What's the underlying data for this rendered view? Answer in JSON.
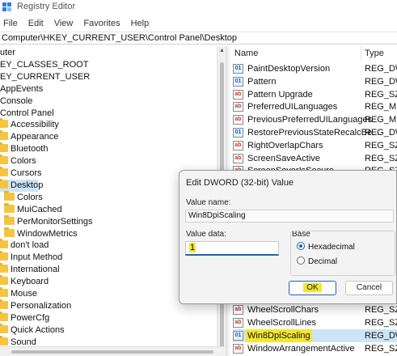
{
  "window": {
    "title": "Registry Editor"
  },
  "menu": [
    "File",
    "Edit",
    "View",
    "Favorites",
    "Help"
  ],
  "address": "Computer\\HKEY_CURRENT_USER\\Control Panel\\Desktop",
  "tree": [
    {
      "label": "uter",
      "indent": 0,
      "folder": false
    },
    {
      "label": "EY_CLASSES_ROOT",
      "indent": 0,
      "folder": false
    },
    {
      "label": "EY_CURRENT_USER",
      "indent": 0,
      "folder": false
    },
    {
      "label": "AppEvents",
      "indent": 0,
      "folder": false
    },
    {
      "label": "Console",
      "indent": 0,
      "folder": false
    },
    {
      "label": "Control Panel",
      "indent": 0,
      "folder": false
    },
    {
      "label": "Accessibility",
      "indent": 1,
      "folder": true
    },
    {
      "label": "Appearance",
      "indent": 1,
      "folder": true
    },
    {
      "label": "Bluetooth",
      "indent": 1,
      "folder": true
    },
    {
      "label": "Colors",
      "indent": 1,
      "folder": true
    },
    {
      "label": "Cursors",
      "indent": 1,
      "folder": true
    },
    {
      "label": "Desktop",
      "indent": 1,
      "folder": true,
      "selected": true
    },
    {
      "label": "Colors",
      "indent": 2,
      "folder": true
    },
    {
      "label": "MuiCached",
      "indent": 2,
      "folder": true
    },
    {
      "label": "PerMonitorSettings",
      "indent": 2,
      "folder": true
    },
    {
      "label": "WindowMetrics",
      "indent": 2,
      "folder": true
    },
    {
      "label": "don't load",
      "indent": 1,
      "folder": true
    },
    {
      "label": "Input Method",
      "indent": 1,
      "folder": true
    },
    {
      "label": "International",
      "indent": 1,
      "folder": true
    },
    {
      "label": "Keyboard",
      "indent": 1,
      "folder": true
    },
    {
      "label": "Mouse",
      "indent": 1,
      "folder": true
    },
    {
      "label": "Personalization",
      "indent": 1,
      "folder": true
    },
    {
      "label": "PowerCfg",
      "indent": 1,
      "folder": true
    },
    {
      "label": "Quick Actions",
      "indent": 1,
      "folder": true
    },
    {
      "label": "Sound",
      "indent": 1,
      "folder": true
    }
  ],
  "list": {
    "col_name": "Name",
    "col_type": "Type",
    "rows": [
      {
        "name": "PaintDesktopVersion",
        "type": "REG_DWO",
        "kind": "dw"
      },
      {
        "name": "Pattern",
        "type": "REG_DWO",
        "kind": "dw"
      },
      {
        "name": "Pattern Upgrade",
        "type": "REG_SZ",
        "kind": "sz"
      },
      {
        "name": "PreferredUILanguages",
        "type": "REG_MUI",
        "kind": "sz"
      },
      {
        "name": "PreviousPreferredUILanguages",
        "type": "REG_MUI",
        "kind": "sz"
      },
      {
        "name": "RestorePreviousStateRecalcBe...",
        "type": "REG_DWO",
        "kind": "dw"
      },
      {
        "name": "RightOverlapChars",
        "type": "REG_SZ",
        "kind": "sz"
      },
      {
        "name": "ScreenSaveActive",
        "type": "REG_SZ",
        "kind": "sz"
      },
      {
        "name": "ScreenSaverIsSecure",
        "type": "REG_SZ",
        "kind": "sz"
      }
    ],
    "rows_bottom": [
      {
        "name": "WheelScrollChars",
        "type": "REG_SZ",
        "kind": "sz"
      },
      {
        "name": "WheelScrollLines",
        "type": "REG_SZ",
        "kind": "sz"
      },
      {
        "name": "Win8DpiScaling",
        "type": "REG_DWO",
        "kind": "dw",
        "highlight": true,
        "selected": true
      },
      {
        "name": "WindowArrangementActive",
        "type": "REG_SZ",
        "kind": "sz"
      }
    ]
  },
  "dialog": {
    "title": "Edit DWORD (32-bit) Value",
    "value_name_label": "Value name:",
    "value_name": "Win8DpiScaling",
    "value_data_label": "Value data:",
    "value_data": "1",
    "base_label": "Base",
    "base_options": [
      "Hexadecimal",
      "Decimal"
    ],
    "base_selected": "Hexadecimal",
    "ok_label": "OK",
    "cancel_label": "Cancel"
  },
  "colors": {
    "highlight": "#f2e633",
    "selection": "#cce4f7",
    "accent": "#1e63b8"
  }
}
